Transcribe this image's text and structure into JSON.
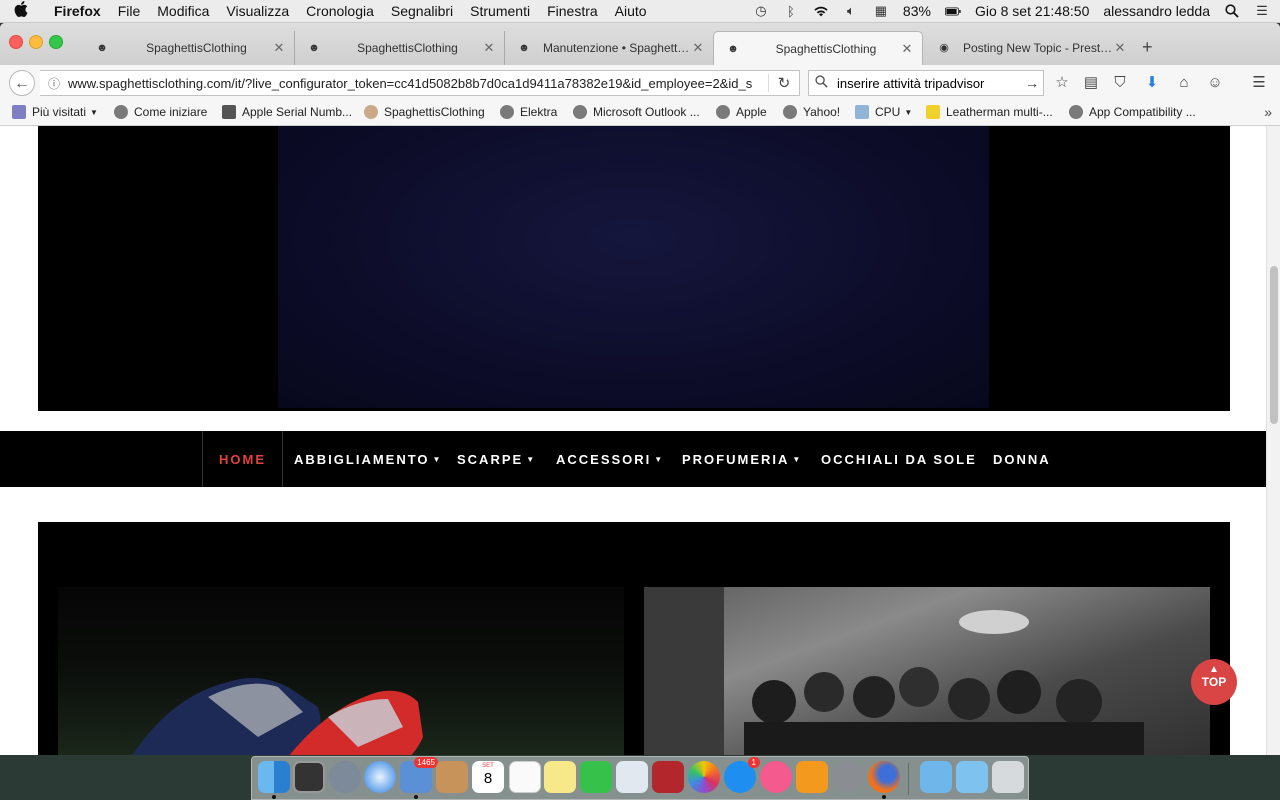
{
  "menubar": {
    "apple": "",
    "app": "Firefox",
    "items": [
      "File",
      "Modifica",
      "Visualizza",
      "Cronologia",
      "Segnalibri",
      "Strumenti",
      "Finestra",
      "Aiuto"
    ],
    "battery": "83%",
    "datetime": "Gio 8 set  21:48:50",
    "user": "alessandro ledda"
  },
  "tabs": [
    {
      "title": "SpaghettisClothing"
    },
    {
      "title": "SpaghettisClothing"
    },
    {
      "title": "Manutenzione • Spaghettis..."
    },
    {
      "title": "SpaghettisClothing"
    },
    {
      "title": "Posting New Topic - Presta..."
    }
  ],
  "url": "www.spaghettisclothing.com/it/?live_configurator_token=cc41d5082b8b7d0ca1d9411a78382e19&id_employee=2&id_s",
  "search": {
    "value": "inserire attività tripadvisor"
  },
  "bookmarks": [
    "Più visitati",
    "Come iniziare",
    "Apple Serial Numb...",
    "SpaghettisClothing",
    "Elektra",
    "Microsoft Outlook ...",
    "Apple",
    "Yahoo!",
    "CPU",
    "Leatherman multi-...",
    "App Compatibility ..."
  ],
  "site": {
    "nav": [
      {
        "label": "HOME",
        "dropdown": false
      },
      {
        "label": "ABBIGLIAMENTO",
        "dropdown": true
      },
      {
        "label": "SCARPE",
        "dropdown": true
      },
      {
        "label": "ACCESSORI",
        "dropdown": true
      },
      {
        "label": "PROFUMERIA",
        "dropdown": true
      },
      {
        "label": "OCCHIALI DA SOLE",
        "dropdown": false
      },
      {
        "label": "DONNA",
        "dropdown": false
      }
    ],
    "top_button": "TOP",
    "accent": "#e0433d"
  },
  "dock": {
    "badges": {
      "mail": "1465",
      "appstore": "1"
    },
    "calendar_day": "8",
    "calendar_month": "SET"
  }
}
